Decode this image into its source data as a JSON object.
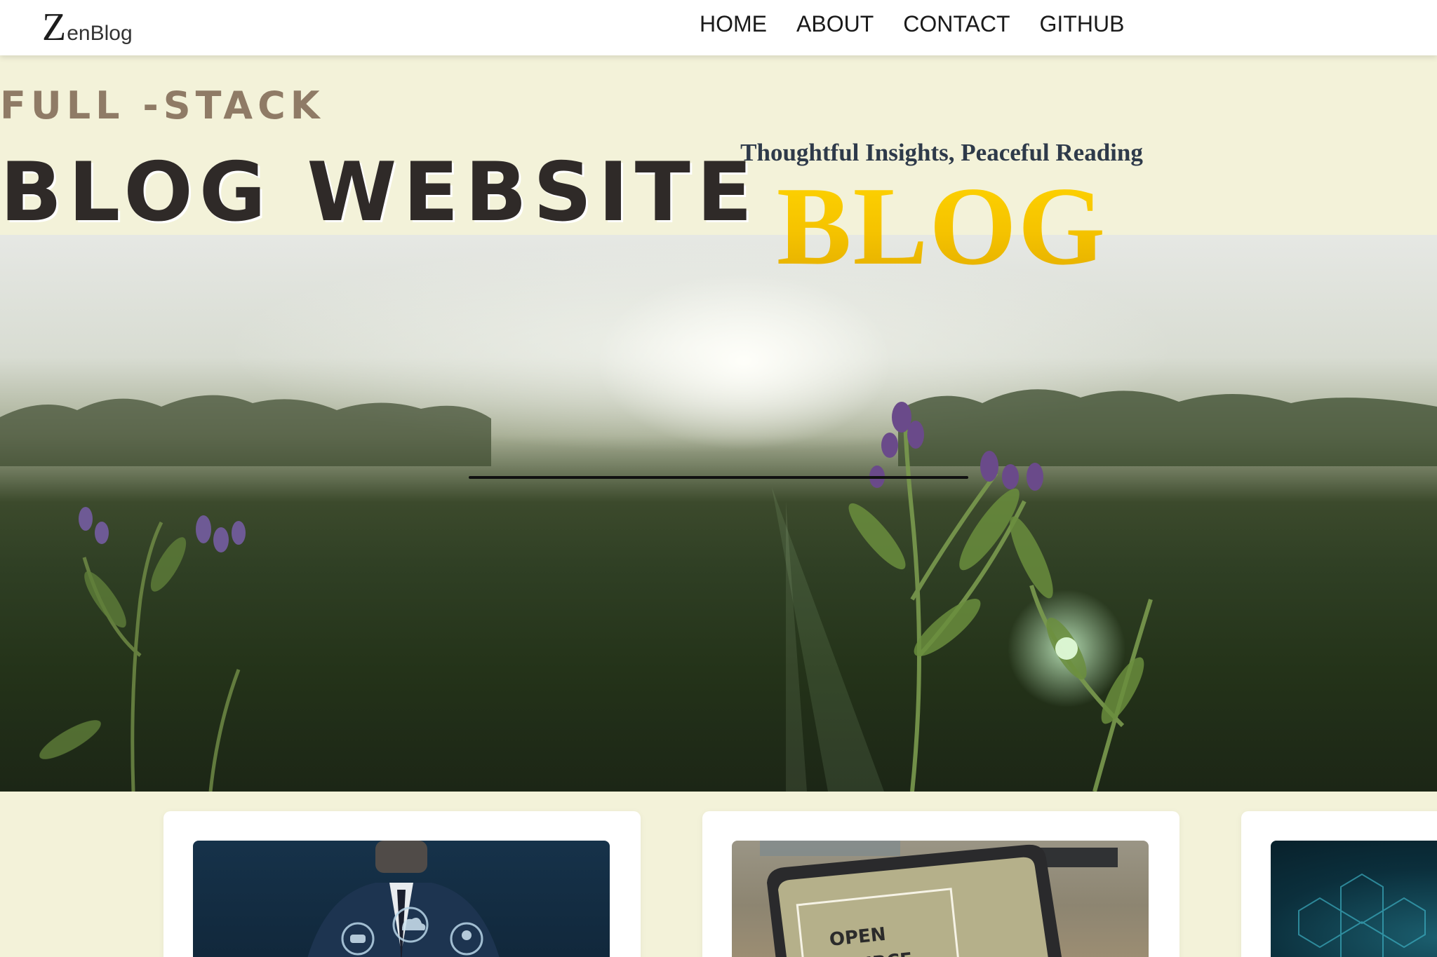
{
  "navbar": {
    "logo": {
      "initial": "Z",
      "rest": "enBlog"
    },
    "links": [
      {
        "label": "HOME"
      },
      {
        "label": "ABOUT"
      },
      {
        "label": "CONTACT"
      },
      {
        "label": "GITHUB"
      }
    ]
  },
  "hero": {
    "subtitle": "FULL -STACK",
    "title": "BLOG WEBSITE",
    "badge": {
      "tagline": "Thoughtful Insights, Peaceful Reading",
      "word": "BLOG"
    }
  },
  "cards": [
    {
      "image_icon": "business-tech-image"
    },
    {
      "image_icon": "open-source-tablet-image",
      "image_text_1": "OPEN",
      "image_text_2": "SOURCE"
    },
    {
      "image_icon": "tech-hexagon-image"
    }
  ],
  "colors": {
    "page_background": "#f3f2d9",
    "subtitle_color": "#8f7b66",
    "title_color": "#2f2a28",
    "badge_gold": "#f5c300",
    "tagline_color": "#2e3a4a"
  }
}
